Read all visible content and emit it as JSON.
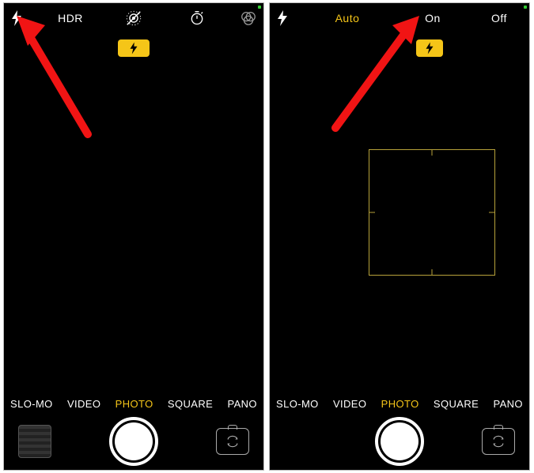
{
  "left": {
    "topbar": {
      "flash_icon": "flash-icon",
      "hdr_label": "HDR",
      "liveoff_icon": "live-photo-off-icon",
      "timer_icon": "timer-icon",
      "filters_icon": "filters-icon"
    },
    "flash_chip": {
      "icon": "flash-icon"
    },
    "modes": [
      "SLO-MO",
      "VIDEO",
      "PHOTO",
      "SQUARE",
      "PANO"
    ],
    "modes_active_index": 2
  },
  "right": {
    "topbar": {
      "flash_icon": "flash-icon",
      "options": {
        "auto": "Auto",
        "on": "On",
        "off": "Off"
      },
      "active_option": "auto"
    },
    "flash_chip": {
      "icon": "flash-icon"
    },
    "modes": [
      "SLO-MO",
      "VIDEO",
      "PHOTO",
      "SQUARE",
      "PANO"
    ],
    "modes_active_index": 2
  },
  "colors": {
    "accent": "#f5c518",
    "annotation": "#f11414"
  }
}
